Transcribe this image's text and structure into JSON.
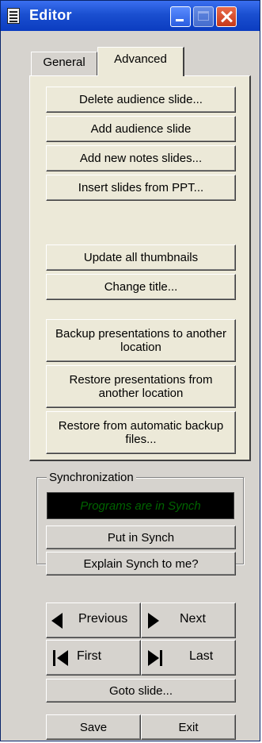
{
  "window": {
    "title": "Editor"
  },
  "tabs": [
    {
      "label": "General",
      "active": false
    },
    {
      "label": "Advanced",
      "active": true
    }
  ],
  "advanced": {
    "buttons": [
      "Delete audience slide...",
      "Add audience slide",
      "Add new notes slides...",
      "Insert slides from PPT...",
      "Update all thumbnails",
      "Change title...",
      "Backup presentations to another location",
      "Restore presentations from another location",
      "Restore from automatic backup files..."
    ]
  },
  "synchronization": {
    "label": "Synchronization",
    "status": "Programs are in Synch",
    "put_in_synch": "Put in Synch",
    "explain": "Explain Synch to me?"
  },
  "navigation": {
    "previous": "Previous",
    "next": "Next",
    "first": "First",
    "last": "Last",
    "goto": "Goto slide...",
    "save": "Save",
    "exit": "Exit"
  },
  "colors": {
    "titlebar": "#1a4fd0",
    "panel": "#ece9d8",
    "window": "#d6d3ce",
    "synch_text": "#006400"
  }
}
